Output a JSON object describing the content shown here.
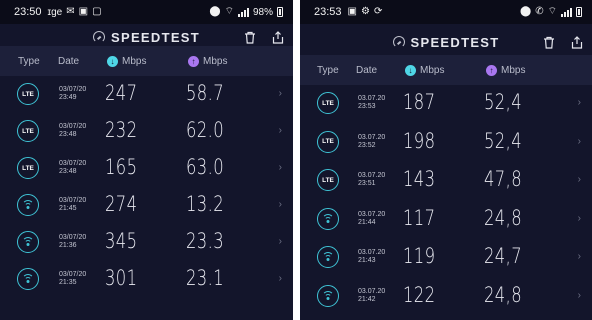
{
  "screens": [
    {
      "status": {
        "time": "23:50",
        "time_suffix": "ɪge",
        "battery": "98%"
      },
      "app_title": "SPEEDTEST",
      "columns": {
        "type": "Type",
        "date": "Date",
        "download": "Mbps",
        "upload": "Mbps"
      },
      "rows": [
        {
          "type": "LTE",
          "date": "03/07/20",
          "time": "23:49",
          "download": "247",
          "upload": "58.7"
        },
        {
          "type": "LTE",
          "date": "03/07/20",
          "time": "23:48",
          "download": "232",
          "upload": "62.0"
        },
        {
          "type": "LTE",
          "date": "03/07/20",
          "time": "23:48",
          "download": "165",
          "upload": "63.0"
        },
        {
          "type": "wifi",
          "date": "03/07/20",
          "time": "21:45",
          "download": "274",
          "upload": "13.2"
        },
        {
          "type": "wifi",
          "date": "03/07/20",
          "time": "21:36",
          "download": "345",
          "upload": "23.3"
        },
        {
          "type": "wifi",
          "date": "03/07/20",
          "time": "21:35",
          "download": "301",
          "upload": "23.1"
        }
      ]
    },
    {
      "status": {
        "time": "23:53"
      },
      "app_title": "SPEEDTEST",
      "columns": {
        "type": "Type",
        "date": "Date",
        "download": "Mbps",
        "upload": "Mbps"
      },
      "rows": [
        {
          "type": "LTE",
          "date": "03.07.20",
          "time": "23:53",
          "download": "187",
          "upload": "52,4"
        },
        {
          "type": "LTE",
          "date": "03.07.20",
          "time": "23:52",
          "download": "198",
          "upload": "52,4"
        },
        {
          "type": "LTE",
          "date": "03.07.20",
          "time": "23:51",
          "download": "143",
          "upload": "47,8"
        },
        {
          "type": "wifi",
          "date": "03.07.20",
          "time": "21:44",
          "download": "117",
          "upload": "24,8"
        },
        {
          "type": "wifi",
          "date": "03.07.20",
          "time": "21:43",
          "download": "119",
          "upload": "24,7"
        },
        {
          "type": "wifi",
          "date": "03.07.20",
          "time": "21:42",
          "download": "122",
          "upload": "24,8"
        }
      ]
    }
  ],
  "colors": {
    "background": "#13152b",
    "header": "#1d203a",
    "download": "#4fd6e6",
    "upload": "#a977f0",
    "type_ring": "#3fc4d6"
  },
  "icons": [
    "speedtest-gauge-icon",
    "trash-icon",
    "share-icon",
    "download-arrow-icon",
    "upload-arrow-icon",
    "lte-icon",
    "wifi-icon",
    "chevron-right-icon"
  ]
}
